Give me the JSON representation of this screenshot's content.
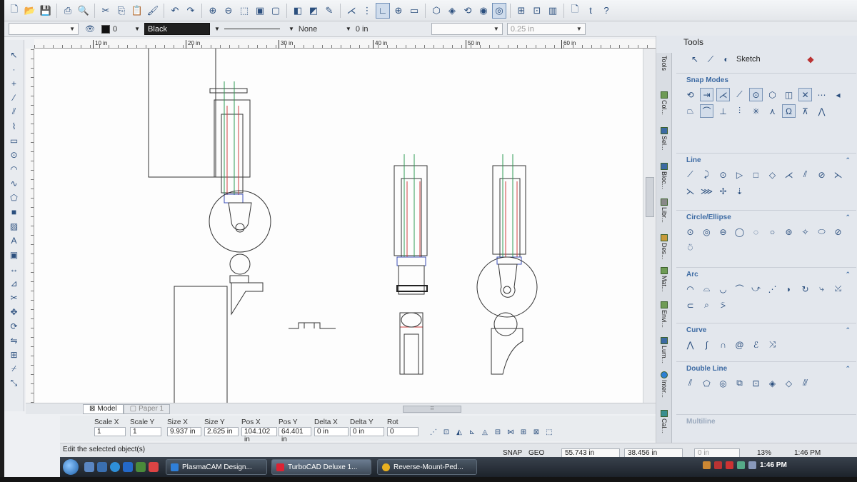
{
  "property_bar": {
    "layer_value": "",
    "pen_width": "0",
    "color": "Black",
    "line_style": "None",
    "thickness": "0 in",
    "text_box": "",
    "line_width": "0.25 in"
  },
  "ruler": {
    "ticks": [
      "10 in",
      "20 in",
      "30 in",
      "40 in",
      "50 in",
      "60 in",
      "70"
    ]
  },
  "tabs": {
    "model": "Model",
    "paper": "Paper 1"
  },
  "inspector": {
    "scale_x_label": "Scale X",
    "scale_x": "1",
    "scale_y_label": "Scale Y",
    "scale_y": "1",
    "size_x_label": "Size X",
    "size_x": "9.937 in",
    "size_y_label": "Size Y",
    "size_y": "2.625 in",
    "pos_x_label": "Pos X",
    "pos_x": "104.102 in",
    "pos_y_label": "Pos Y",
    "pos_y": "64.401 in",
    "delta_x_label": "Delta X",
    "delta_x": "0 in",
    "delta_y_label": "Delta Y",
    "delta_y": "0 in",
    "rot_label": "Rot",
    "rot": "0"
  },
  "status": {
    "message": "Edit the selected object(s)",
    "snap": "SNAP",
    "geo": "GEO",
    "coord_x": "55.743 in",
    "coord_y": "38.456 in",
    "angle": "0 in",
    "zoom": "13%",
    "time": "1:46 PM"
  },
  "right_panel": {
    "title": "Tools",
    "mode": "Sketch",
    "side_tabs": [
      "Tools",
      "Col...",
      "Sel...",
      "Bloc...",
      "Libr...",
      "Des...",
      "Mat...",
      "Envi...",
      "Lum...",
      "Inter...",
      "Cal..."
    ],
    "sections": {
      "snap_modes": "Snap Modes",
      "line": "Line",
      "circle": "Circle/Ellipse",
      "arc": "Arc",
      "curve": "Curve",
      "double_line": "Double Line",
      "multiline": "Multiline"
    }
  },
  "taskbar": {
    "tasks": [
      "PlasmaCAM Design...",
      "TurboCAD Deluxe 1...",
      "Reverse-Mount-Ped..."
    ],
    "time": "1:46 PM"
  },
  "icons": {
    "new": "new-file-icon",
    "open": "open-folder-icon",
    "save": "save-icon",
    "print": "print-icon",
    "cut": "scissors-icon",
    "copy": "copy-icon",
    "paste": "paste-icon",
    "undo": "undo-icon",
    "redo": "redo-icon",
    "help": "help-icon"
  }
}
